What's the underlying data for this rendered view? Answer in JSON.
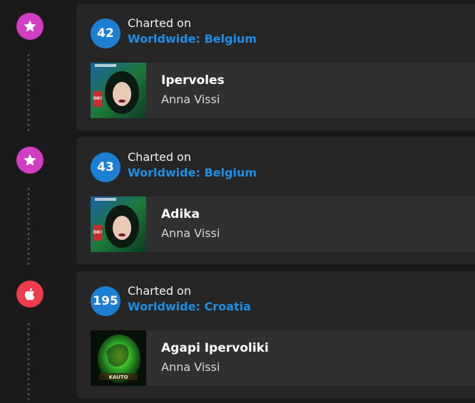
{
  "entries": [
    {
      "platform_icon": "star-icon",
      "platform_color": "#d13ec4",
      "rank": "42",
      "charted_label": "Charted on",
      "chart_name": "Worldwide: Belgium",
      "track_title": "Ipervoles",
      "artist": "Anna Vissi",
      "cover_logo": "OK!"
    },
    {
      "platform_icon": "star-icon",
      "platform_color": "#d13ec4",
      "rank": "43",
      "charted_label": "Charted on",
      "chart_name": "Worldwide: Belgium",
      "track_title": "Adika",
      "artist": "Anna Vissi",
      "cover_logo": "OK!"
    },
    {
      "platform_icon": "apple-icon",
      "platform_color": "#ef3b4c",
      "rank": "195",
      "charted_label": "Charted on",
      "chart_name": "Worldwide: Croatia",
      "track_title": "Agapi Ipervoliki",
      "artist": "Anna Vissi",
      "cover_logo": "KAUTO"
    }
  ],
  "colors": {
    "background": "#1a1a1a",
    "card": "#262626",
    "track_row": "#303030",
    "rank_badge": "#1d7fd1",
    "chart_link": "#1f8fe6"
  }
}
